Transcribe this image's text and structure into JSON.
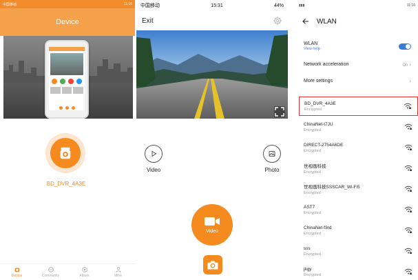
{
  "panel1": {
    "status_left": "中国移动",
    "status_right": "11:16",
    "title": "Device",
    "device_name": "BD_DVR_4A3E",
    "nav": [
      {
        "label": "Device",
        "icon": "device-icon"
      },
      {
        "label": "Community",
        "icon": "community-icon"
      },
      {
        "label": "Album",
        "icon": "album-icon"
      },
      {
        "label": "Mine",
        "icon": "mine-icon"
      }
    ],
    "accent": "#f58a1f"
  },
  "panel2": {
    "status_carrier": "中国移动",
    "status_time": "15:31",
    "status_battery": "44%",
    "exit_label": "Exit",
    "video_label": "Video",
    "photo_label": "Photo",
    "record_label": "Video"
  },
  "panel3": {
    "status_right": "11:16",
    "title": "WLAN",
    "wlan_label": "WLAN",
    "view_help": "View help",
    "network_acceleration": "Network acceleration",
    "network_acceleration_value": "On",
    "more_settings": "More settings",
    "networks": [
      {
        "name": "BD_DVR_4A3E",
        "security": "Encrypted",
        "selected": true
      },
      {
        "name": "ChinaNet-t7JU",
        "security": "Encrypted"
      },
      {
        "name": "DIRECT-2754A6DE",
        "security": "Encrypted"
      },
      {
        "name": "世视画科技",
        "security": "Encrypted"
      },
      {
        "name": "世视画科技SSSCAR_Wi-Fi5",
        "security": "Encrypted"
      },
      {
        "name": "AST7",
        "security": "Encrypted"
      },
      {
        "name": "ChinaNet-f3rd",
        "security": "Encrypted"
      },
      {
        "name": "sss",
        "security": "Encrypted"
      },
      {
        "name": "jkgy",
        "security": "Encrypted"
      }
    ],
    "toggle_color": "#3a7bd5",
    "highlight_color": "#dd3333"
  }
}
